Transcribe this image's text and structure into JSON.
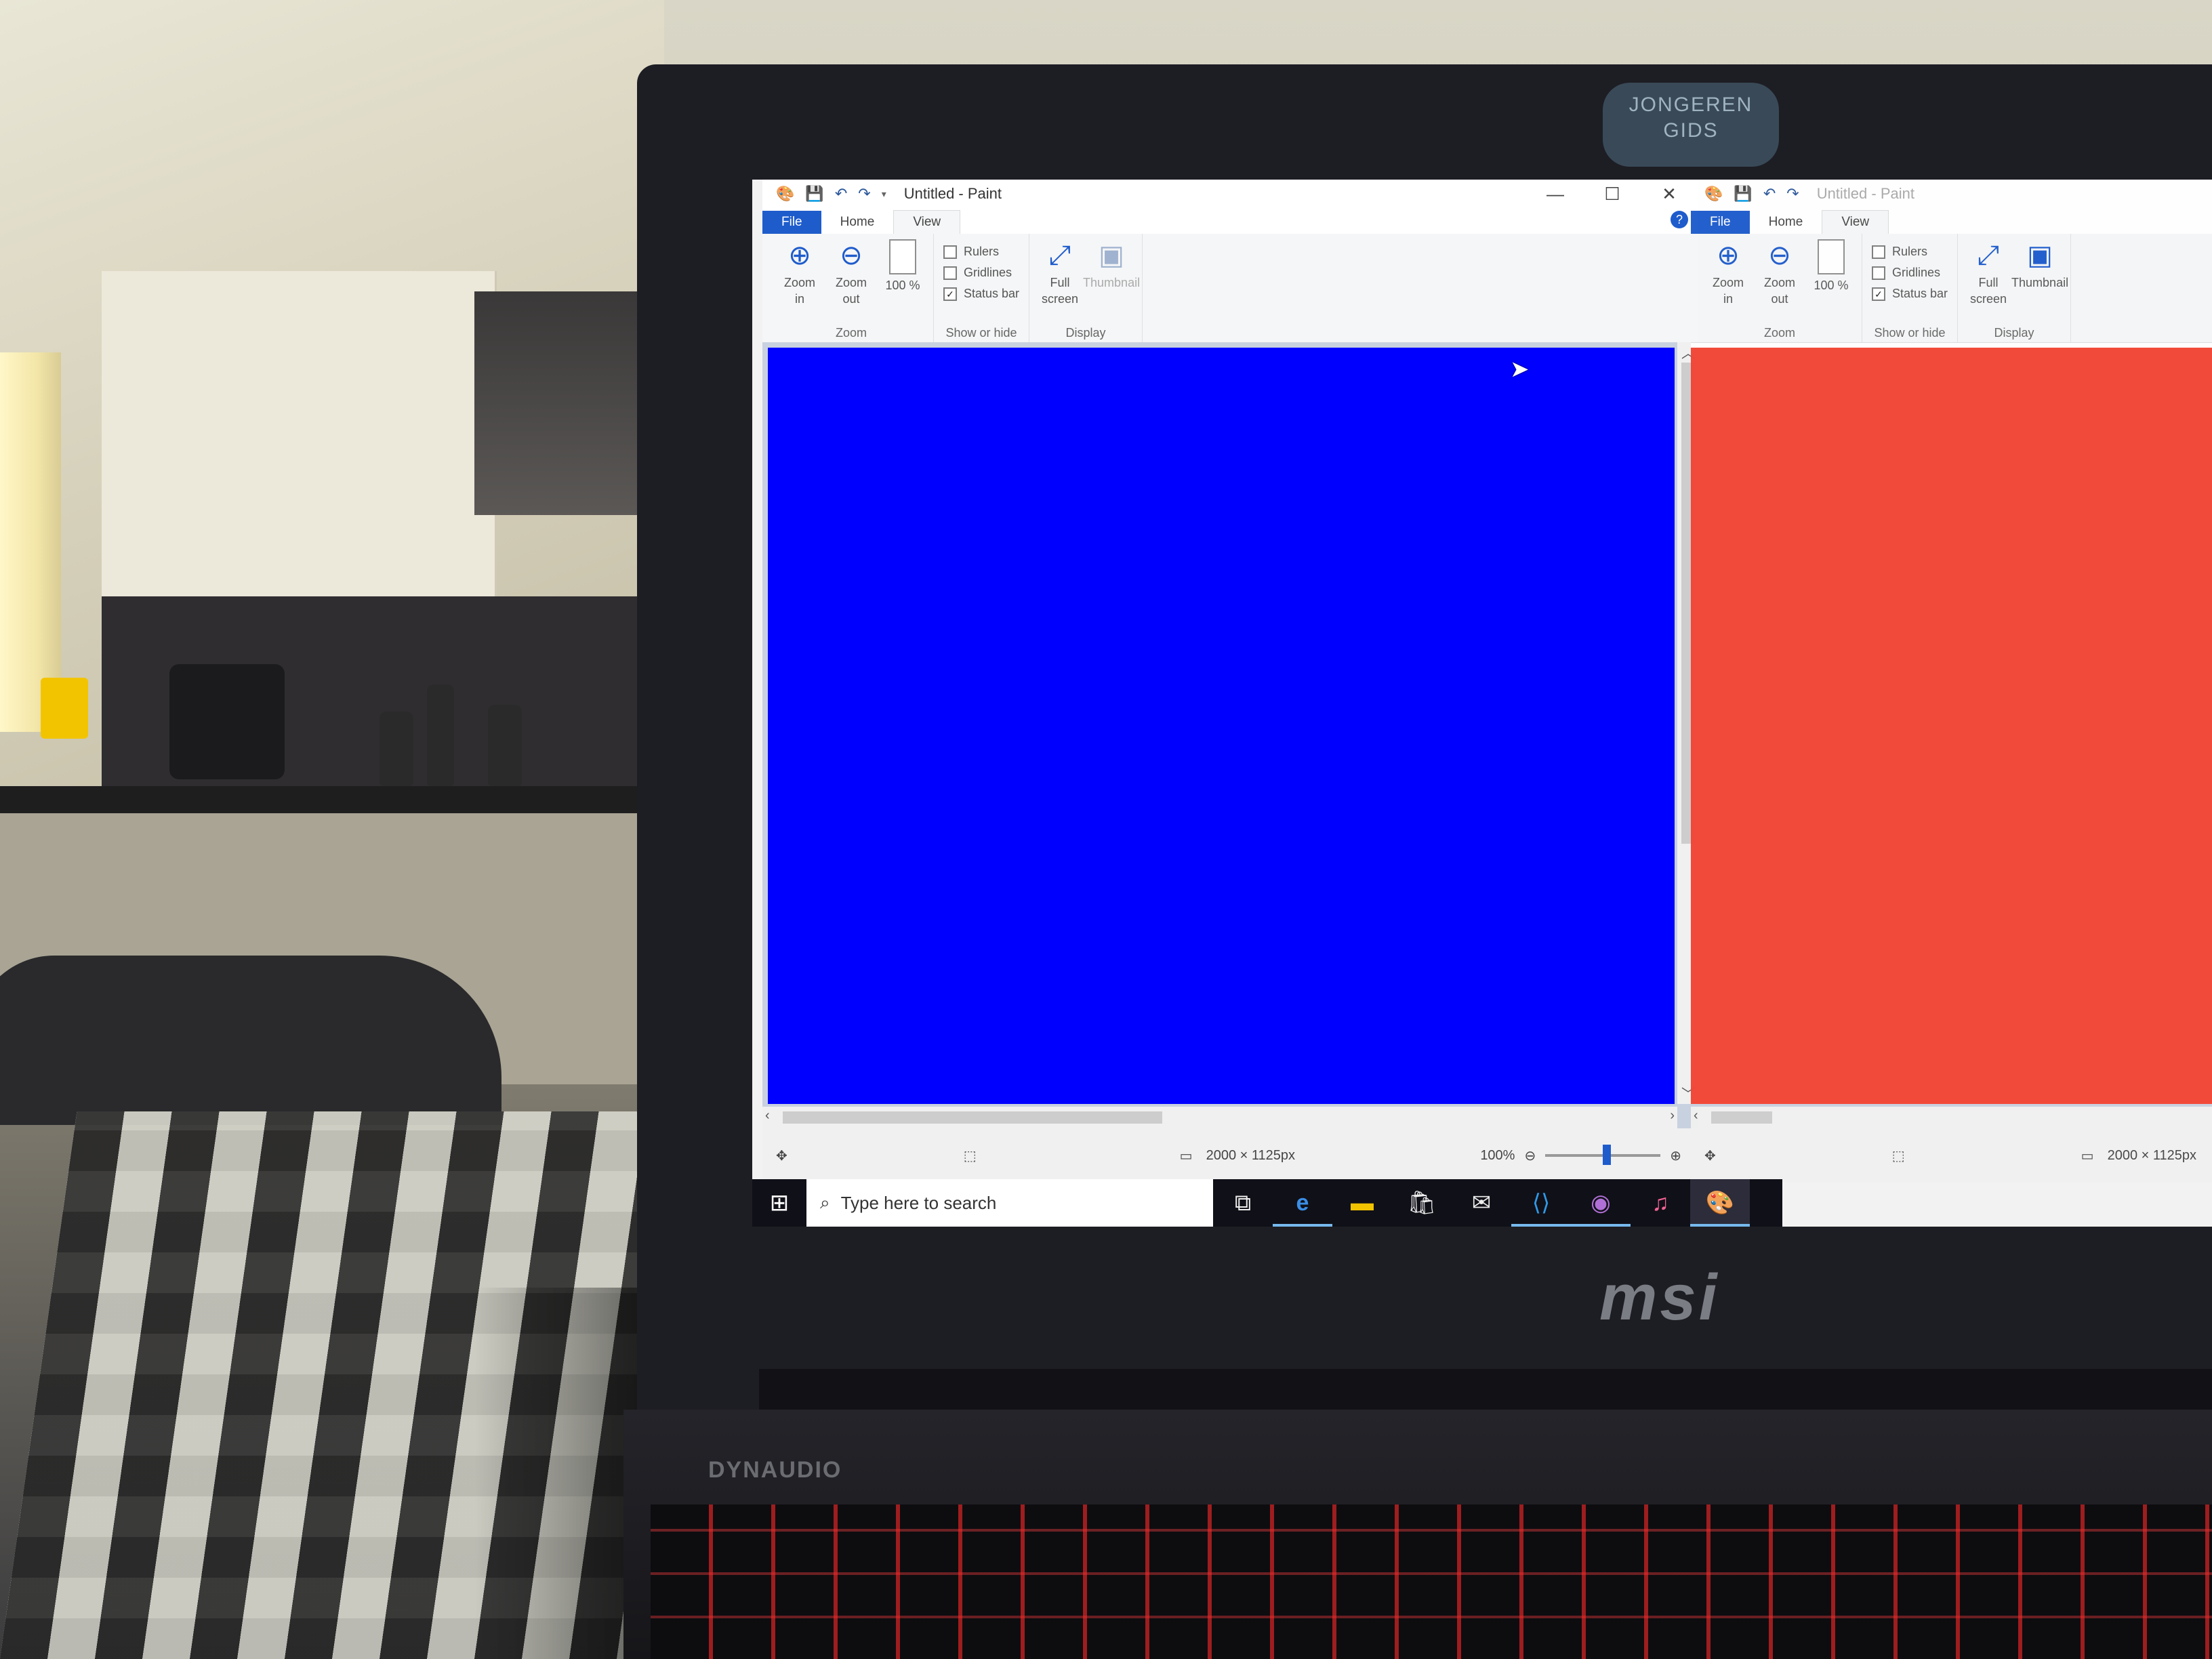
{
  "bezel_tag": "JONGEREN GIDS",
  "brand": "msi",
  "audio_brand": "DYNAUDIO",
  "colors": {
    "canvas_main": "#0000ff",
    "canvas_second": "#f24535",
    "file_tab": "#1e5ccc",
    "taskbar": "#101018"
  },
  "paint_windows": [
    {
      "title": "Untitled - Paint",
      "tabs": {
        "file": "File",
        "home": "Home",
        "view": "View"
      },
      "zoom_group": {
        "zoom_in": "Zoom in",
        "zoom_out": "Zoom out",
        "hundred": "100 %",
        "label": "Zoom"
      },
      "show_hide_group": {
        "rulers": "Rulers",
        "gridlines": "Gridlines",
        "status_bar": "Status bar",
        "rulers_checked": false,
        "gridlines_checked": false,
        "status_bar_checked": true,
        "label": "Show or hide"
      },
      "display_group": {
        "full_screen": "Full screen",
        "thumbnail": "Thumbnail",
        "label": "Display"
      },
      "status": {
        "image_size": "2000 × 1125px",
        "zoom": "100%",
        "zoom_slider_fraction": 0.5
      }
    },
    {
      "title": "Untitled - Paint",
      "tabs": {
        "file": "File",
        "home": "Home",
        "view": "View"
      },
      "zoom_group": {
        "zoom_in": "Zoom in",
        "zoom_out": "Zoom out",
        "hundred": "100 %",
        "label": "Zoom"
      },
      "show_hide_group": {
        "rulers": "Rulers",
        "gridlines": "Gridlines",
        "status_bar": "Status bar",
        "label": "Show or hide"
      },
      "display_group": {
        "full_screen": "Full screen",
        "thumbnail": "Thumbnail",
        "label": "Display"
      },
      "status": {
        "image_size": "2000 × 1125px"
      }
    }
  ],
  "taskbar": {
    "search_placeholder": "Type here to search",
    "icons": [
      "windows-start-icon",
      "task-view-icon",
      "edge-icon",
      "file-explorer-icon",
      "store-icon",
      "mail-icon",
      "vscode-icon",
      "github-icon",
      "itunes-icon",
      "paint-icon"
    ]
  }
}
